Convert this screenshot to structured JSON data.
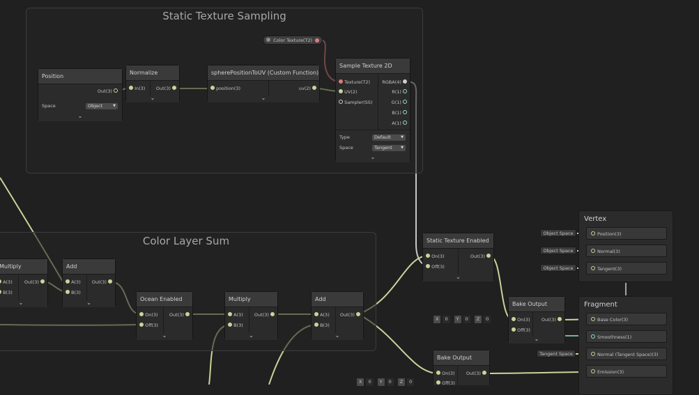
{
  "colors": {
    "wire": "#c8d59a",
    "texture_wire": "#e07a7a",
    "background": "#202020"
  },
  "groups": {
    "static": {
      "title": "Static Texture Sampling"
    },
    "color_sum": {
      "title": "Color Layer Sum"
    }
  },
  "property": {
    "label": "Color Texture(T2)"
  },
  "nodes": {
    "position": {
      "title": "Position",
      "out": "Out(3)",
      "space_label": "Space",
      "space_value": "Object"
    },
    "normalize": {
      "title": "Normalize",
      "in": "In(3)",
      "out": "Out(3)"
    },
    "sphere": {
      "title": "spherePositionToUV (Custom Function)",
      "in": "position(3)",
      "out": "uv(2)"
    },
    "sample": {
      "title": "Sample Texture 2D",
      "in_texture": "Texture(T2)",
      "in_uv": "UV(2)",
      "in_sampler": "Sampler(SS)",
      "out_rgba": "RGBA(4)",
      "out_r": "R(1)",
      "out_g": "G(1)",
      "out_b": "B(1)",
      "out_a": "A(1)",
      "type_label": "Type",
      "type_value": "Default",
      "space_label": "Space",
      "space_value": "Tangent"
    },
    "multiply_left": {
      "title": "Multiply",
      "a": "A(3)",
      "b": "B(3)",
      "out": "Out(3)"
    },
    "add_left": {
      "title": "Add",
      "a": "A(3)",
      "b": "B(3)",
      "out": "Out(3)"
    },
    "ocean": {
      "title": "Ocean Enabled",
      "on": "On(3)",
      "off": "Off(3)",
      "out": "Out(3)"
    },
    "multiply_mid": {
      "title": "Multiply",
      "a": "A(3)",
      "b": "B(3)",
      "out": "Out(3)"
    },
    "add_mid": {
      "title": "Add",
      "a": "A(3)",
      "b": "B(3)",
      "out": "Out(3)"
    },
    "static_enabled": {
      "title": "Static Texture Enabled",
      "on": "On(3)",
      "off": "Off(3)",
      "out": "Out(3)"
    },
    "bake1": {
      "title": "Bake Output",
      "on": "On(3)",
      "off": "Off(3)",
      "out": "Out(3)"
    },
    "bake2": {
      "title": "Bake Output",
      "on": "On(3)",
      "off": "Off(3)",
      "out": "Out(3)"
    }
  },
  "vectors": {
    "bake1": {
      "x_label": "X",
      "x": "0",
      "y_label": "Y",
      "y": "0",
      "z_label": "Z",
      "z": "0"
    },
    "bake2": {
      "x_label": "X",
      "x": "0",
      "y_label": "Y",
      "y": "0",
      "z_label": "Z",
      "z": "0"
    }
  },
  "vertex": {
    "title": "Vertex",
    "slots": [
      "Position(3)",
      "Normal(3)",
      "Tangent(3)"
    ],
    "chips": [
      "Object Space",
      "Object Space",
      "Object Space"
    ]
  },
  "fragment": {
    "title": "Fragment",
    "slots": [
      "Base Color(3)",
      "Smoothness(1)",
      "Normal (Tangent Space)(3)",
      "Emission(3)"
    ],
    "chip": "Tangent Space"
  },
  "collapse_glyph": "⌄"
}
